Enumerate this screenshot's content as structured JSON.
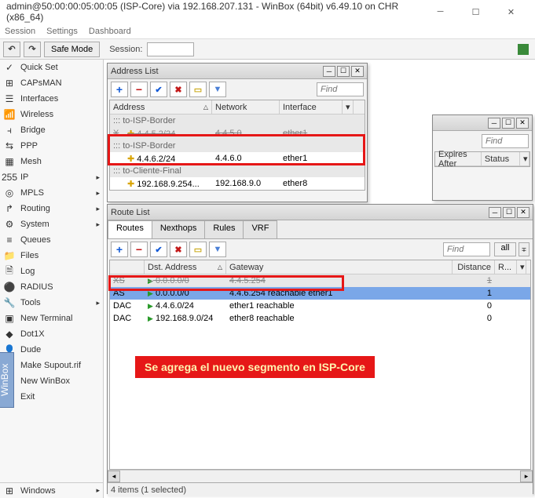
{
  "title": "admin@50:00:00:05:00:05 (ISP-Core) via 192.168.207.131 - WinBox (64bit) v6.49.10 on CHR (x86_64)",
  "menubar": [
    "Session",
    "Settings",
    "Dashboard"
  ],
  "toolbar": {
    "safe": "Safe Mode",
    "session": "Session:"
  },
  "sidebar": {
    "items": [
      {
        "icon": "✓",
        "label": "Quick Set"
      },
      {
        "icon": "⊞",
        "label": "CAPsMAN"
      },
      {
        "icon": "☰",
        "label": "Interfaces"
      },
      {
        "icon": "📶",
        "label": "Wireless"
      },
      {
        "icon": "⫞",
        "label": "Bridge"
      },
      {
        "icon": "⇆",
        "label": "PPP"
      },
      {
        "icon": "▦",
        "label": "Mesh"
      },
      {
        "icon": "255",
        "label": "IP"
      },
      {
        "icon": "◎",
        "label": "MPLS"
      },
      {
        "icon": "↱",
        "label": "Routing"
      },
      {
        "icon": "⚙",
        "label": "System"
      },
      {
        "icon": "≡",
        "label": "Queues"
      },
      {
        "icon": "📁",
        "label": "Files"
      },
      {
        "icon": "🗎",
        "label": "Log"
      },
      {
        "icon": "⚫",
        "label": "RADIUS"
      },
      {
        "icon": "🔧",
        "label": "Tools"
      },
      {
        "icon": "▣",
        "label": "New Terminal"
      },
      {
        "icon": "◆",
        "label": "Dot1X"
      },
      {
        "icon": "👤",
        "label": "Dude"
      },
      {
        "icon": "📄",
        "label": "Make Supout.rif"
      },
      {
        "icon": "◉",
        "label": "New WinBox"
      },
      {
        "icon": "⏏",
        "label": "Exit"
      }
    ],
    "bottom": {
      "icon": "⊞",
      "label": "Windows"
    }
  },
  "addrWin": {
    "title": "Address List",
    "find": "Find",
    "headers": [
      "Address",
      "Network",
      "Interface"
    ],
    "rows": [
      {
        "type": "section",
        "label": "::: to-ISP-Border"
      },
      {
        "type": "struck",
        "flag": "X",
        "addr": "4.4.5.2/24",
        "net": "4.4.5.0",
        "iface": "ether1"
      },
      {
        "type": "section",
        "label": "::: to-ISP-Border"
      },
      {
        "type": "normal",
        "addr": "4.4.6.2/24",
        "net": "4.4.6.0",
        "iface": "ether1"
      },
      {
        "type": "section",
        "label": "::: to-Cliente-Final"
      },
      {
        "type": "normal",
        "addr": "192.168.9.254...",
        "net": "192.168.9.0",
        "iface": "ether8"
      }
    ]
  },
  "bgWin": {
    "find": "Find",
    "headers": [
      "Expires After",
      "Status"
    ]
  },
  "routeWin": {
    "title": "Route List",
    "tabs": [
      "Routes",
      "Nexthops",
      "Rules",
      "VRF"
    ],
    "find": "Find",
    "all": "all",
    "headers": [
      "",
      "Dst. Address",
      "Gateway",
      "Distance",
      "R..."
    ],
    "rows": [
      {
        "flag": "XS",
        "dst": "0.0.0.0/0",
        "gw": "4.4.5.254",
        "dist": "1",
        "struck": true
      },
      {
        "flag": "AS",
        "dst": "0.0.0.0/0",
        "gw": "4.4.6.254 reachable ether1",
        "dist": "1",
        "hl": true
      },
      {
        "flag": "DAC",
        "dst": "4.4.6.0/24",
        "gw": "ether1 reachable",
        "dist": "0"
      },
      {
        "flag": "DAC",
        "dst": "192.168.9.0/24",
        "gw": "ether8 reachable",
        "dist": "0"
      }
    ],
    "status": "4 items (1 selected)"
  },
  "annotation": "Se agrega el nuevo segmento en ISP-Core"
}
